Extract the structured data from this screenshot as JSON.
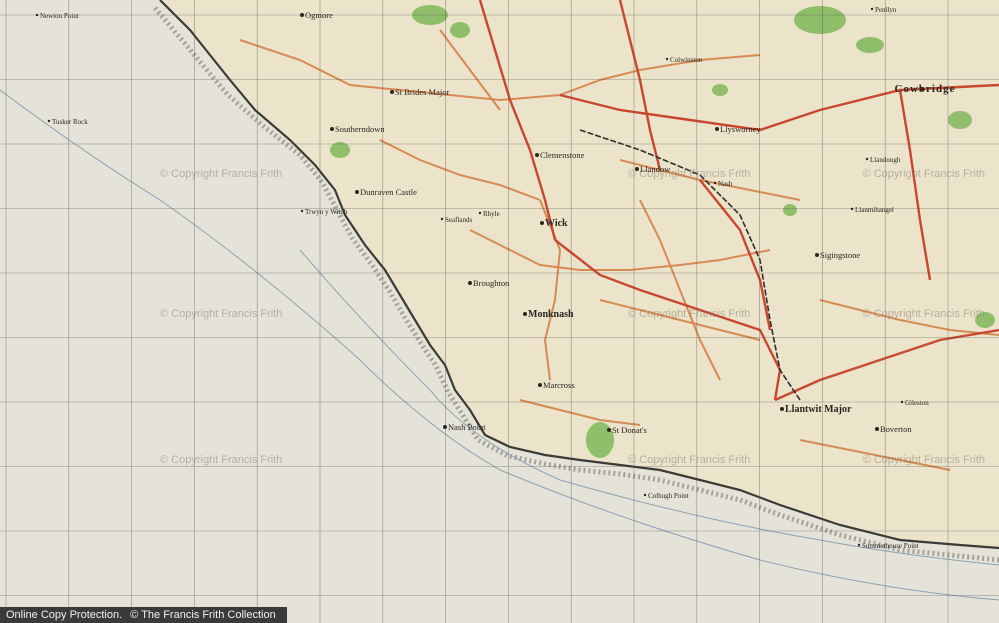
{
  "map": {
    "colors": {
      "sea": "#e6e4da",
      "land": "#ebe2cc",
      "road_main": "#c9472f",
      "road_minor": "#d78a52",
      "woods": "#7fb85a",
      "grid": "#4a4a4a",
      "coast": "#3b3a36",
      "rail": "#2e2e2e"
    },
    "places": [
      {
        "name": "Newton Point",
        "kind": "small"
      },
      {
        "name": "Ogmore",
        "kind": "mid"
      },
      {
        "name": "St Brides Major",
        "kind": "mid"
      },
      {
        "name": "Southerndown",
        "kind": "mid"
      },
      {
        "name": "Dunraven Castle",
        "kind": "mid"
      },
      {
        "name": "Clemenstone",
        "kind": "mid"
      },
      {
        "name": "Llandow",
        "kind": "mid"
      },
      {
        "name": "Llysworney",
        "kind": "mid"
      },
      {
        "name": "Wick",
        "kind": "big"
      },
      {
        "name": "Broughton",
        "kind": "mid"
      },
      {
        "name": "Monknash",
        "kind": "big"
      },
      {
        "name": "Marcross",
        "kind": "mid"
      },
      {
        "name": "St Donat's",
        "kind": "mid"
      },
      {
        "name": "Nash Point",
        "kind": "mid"
      },
      {
        "name": "Llantwit Major",
        "kind": "big"
      },
      {
        "name": "Cowbridge",
        "kind": "town"
      },
      {
        "name": "Llandough",
        "kind": "small"
      },
      {
        "name": "Sigingstone",
        "kind": "mid"
      },
      {
        "name": "Boverton",
        "kind": "mid"
      },
      {
        "name": "Colhugh Point",
        "kind": "small"
      },
      {
        "name": "Summerhouse Point",
        "kind": "small"
      },
      {
        "name": "Tusker Rock",
        "kind": "small"
      },
      {
        "name": "Trwyn y Witch",
        "kind": "small"
      },
      {
        "name": "Penllyn",
        "kind": "small"
      },
      {
        "name": "Colwinston",
        "kind": "small"
      },
      {
        "name": "Nash",
        "kind": "small"
      },
      {
        "name": "Llanmihangel",
        "kind": "small"
      },
      {
        "name": "Gileston",
        "kind": "small"
      },
      {
        "name": "Rhyle",
        "kind": "small"
      },
      {
        "name": "Seaflands",
        "kind": "small"
      }
    ],
    "watermarks": [
      "© Copyright Francis Frith",
      "© Copyright Francis Frith",
      "© Copyright Francis Frith",
      "© Copyright Francis Frith",
      "© Copyright Francis Frith",
      "© Copyright Francis Frith",
      "© Copyright Francis Frith",
      "© Copyright Francis Frith",
      "© Copyright Francis Frith"
    ]
  },
  "footer": {
    "protection": "Online Copy Protection.",
    "copyright": "© The Francis Frith Collection"
  }
}
